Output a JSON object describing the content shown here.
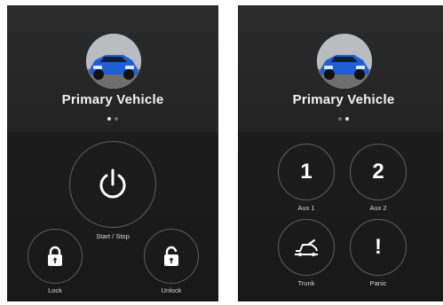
{
  "left_screen": {
    "vehicle_title": "Primary Vehicle",
    "page_dots": {
      "count": 2,
      "active_index": 0
    },
    "buttons": {
      "start_stop": {
        "label": "Start / Stop",
        "icon": "power-icon"
      },
      "lock": {
        "label": "Lock",
        "icon": "lock-icon"
      },
      "unlock": {
        "label": "Unlock",
        "icon": "unlock-icon"
      }
    }
  },
  "right_screen": {
    "vehicle_title": "Primary Vehicle",
    "page_dots": {
      "count": 2,
      "active_index": 1
    },
    "buttons": {
      "aux1": {
        "symbol": "1",
        "label": "Aux 1"
      },
      "aux2": {
        "symbol": "2",
        "label": "Aux 2"
      },
      "trunk": {
        "label": "Trunk",
        "icon": "trunk-icon"
      },
      "panic": {
        "symbol": "!",
        "label": "Panic"
      }
    }
  },
  "colors": {
    "background": "#232323",
    "text": "#f2f2f2",
    "ring": "#5a5a5a",
    "car": "#1f5fd6"
  }
}
